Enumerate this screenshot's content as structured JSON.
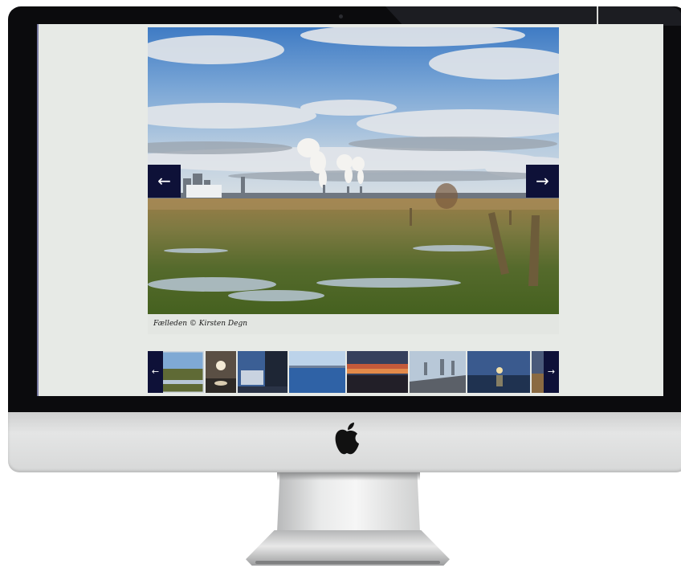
{
  "gallery": {
    "caption": "Fælleden © Kirsten Degn",
    "prev_glyph": "←",
    "next_glyph": "→",
    "thumb_prev_glyph": "←",
    "thumb_next_glyph": "→",
    "thumbnails": [
      {
        "subject": "wetland meadow",
        "selected": true
      },
      {
        "subject": "sun over water"
      },
      {
        "subject": "modern buildings"
      },
      {
        "subject": "blue harbour"
      },
      {
        "subject": "sunset sky"
      },
      {
        "subject": "bridge road"
      },
      {
        "subject": "sunset sea"
      },
      {
        "subject": "partial thumbnail"
      }
    ]
  },
  "device": {
    "logo": "apple-logo"
  },
  "colors": {
    "screen_bg": "#e7eae6",
    "nav_button": "#0e1138",
    "bezel": "#0b0b0d",
    "chin": "#dcdddd"
  }
}
